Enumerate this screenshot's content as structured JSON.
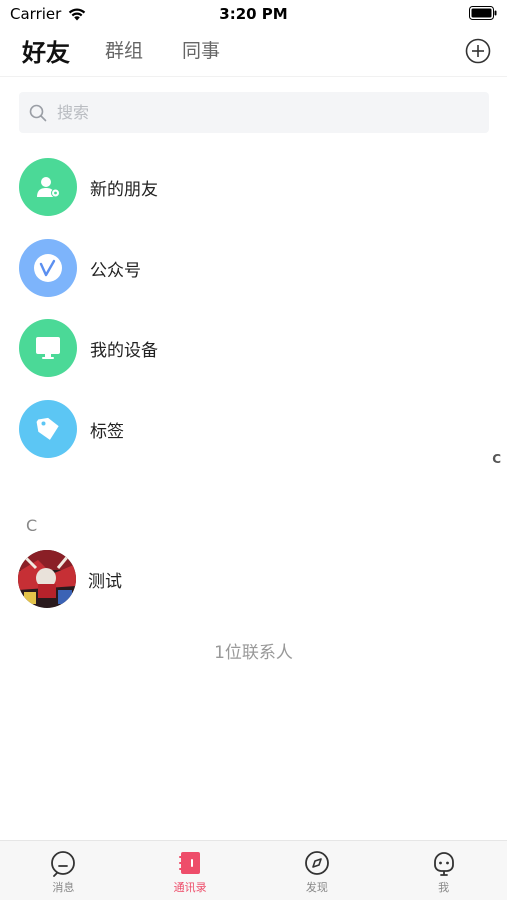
{
  "status_bar": {
    "carrier": "Carrier",
    "time": "3:20 PM"
  },
  "header": {
    "tabs": [
      {
        "label": "好友",
        "active": true
      },
      {
        "label": "群组",
        "active": false
      },
      {
        "label": "同事",
        "active": false
      }
    ]
  },
  "search": {
    "placeholder": "搜索",
    "value": ""
  },
  "menu": [
    {
      "label": "新的朋友",
      "icon": "person-add-icon",
      "color": "#4bd997"
    },
    {
      "label": "公众号",
      "icon": "v-logo-icon",
      "color": "#7db4fb"
    },
    {
      "label": "我的设备",
      "icon": "monitor-icon",
      "color": "#4bd997"
    },
    {
      "label": "标签",
      "icon": "tag-icon",
      "color": "#5cc6f4"
    }
  ],
  "index_bar": [
    "C"
  ],
  "sections": [
    {
      "letter": "C",
      "contacts": [
        {
          "name": "测试",
          "avatar": "photo-avatar"
        }
      ]
    }
  ],
  "contact_count": "1位联系人",
  "tabbar": [
    {
      "label": "消息",
      "icon": "message-icon",
      "active": false
    },
    {
      "label": "通讯录",
      "icon": "contacts-book-icon",
      "active": true
    },
    {
      "label": "发现",
      "icon": "compass-icon",
      "active": false
    },
    {
      "label": "我",
      "icon": "profile-face-icon",
      "active": false
    }
  ],
  "colors": {
    "accent": "#ee4d6a",
    "search_bg": "#f4f5f7",
    "tabbar_bg": "#f7f7f7"
  }
}
